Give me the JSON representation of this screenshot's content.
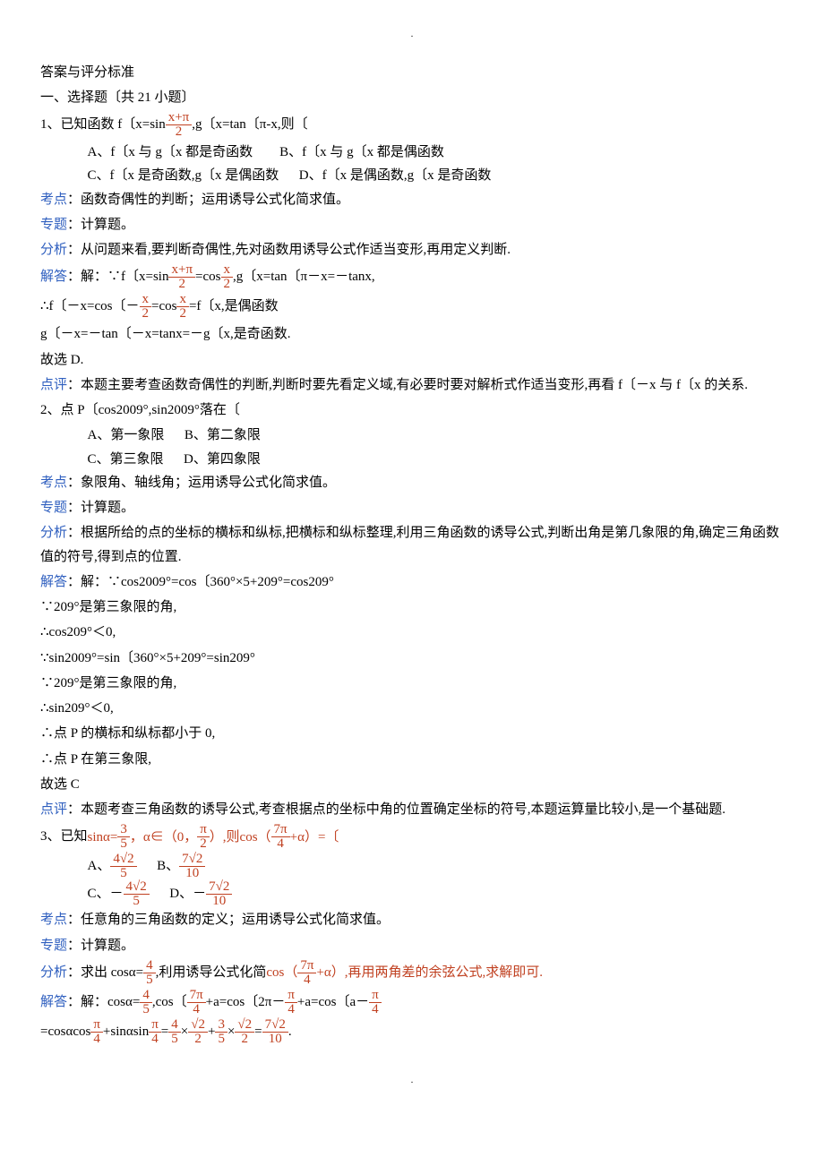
{
  "pageHeader": ".",
  "pageFooter": ".",
  "header1": "答案与评分标准",
  "header2": "一、选择题〔共 21 小题〕",
  "labels": {
    "kao": "考点",
    "zhuan": "专题",
    "fen": "分析",
    "jie": "解答",
    "ping": "点评"
  },
  "q1": {
    "stem_pre": "1、已知函数 f〔x=sin",
    "stem_post": ",g〔x=tan〔π-x,则〔",
    "frac1_num": "x+π",
    "frac1_den": "2",
    "optA": "A、f〔x 与 g〔x 都是奇函数",
    "optB": "B、f〔x 与 g〔x 都是偶函数",
    "optC": "C、f〔x 是奇函数,g〔x 是偶函数",
    "optD": "D、f〔x 是偶函数,g〔x 是奇函数",
    "kao": "：函数奇偶性的判断；运用诱导公式化简求值。",
    "zhuan": "：计算题。",
    "fen": "：从问题来看,要判断奇偶性,先对函数用诱导公式作适当变形,再用定义判断.",
    "jie_pre": "：解：∵f〔x=sin",
    "jie_mid1_num": "x+π",
    "jie_mid1_den": "2",
    "jie_mid2": "=cos",
    "jie_mid3_num": "x",
    "jie_mid3_den": "2",
    "jie_post": ",g〔x=tan〔π－x=－tanx,",
    "line2_pre": "∴f〔－x=cos〔－",
    "line2_mid_num": "x",
    "line2_mid_den": "2",
    "line2_mid2": "=cos",
    "line2_mid3_num": "x",
    "line2_mid3_den": "2",
    "line2_post": "=f〔x,是偶函数",
    "line3": "g〔－x=－tan〔－x=tanx=－g〔x,是奇函数.",
    "line4": "故选 D.",
    "ping": "：本题主要考查函数奇偶性的判断,判断时要先看定义域,有必要时要对解析式作适当变形,再看 f〔－x 与 f〔x 的关系."
  },
  "q2": {
    "stem": "2、点 P〔cos2009°,sin2009°落在〔",
    "optA": "A、第一象限",
    "optB": "B、第二象限",
    "optC": "C、第三象限",
    "optD": "D、第四象限",
    "kao": "：象限角、轴线角；运用诱导公式化简求值。",
    "zhuan": "：计算题。",
    "fen": "：根据所给的点的坐标的横标和纵标,把横标和纵标整理,利用三角函数的诱导公式,判断出角是第几象限的角,确定三角函数值的符号,得到点的位置.",
    "jie1": "：解：∵cos2009°=cos〔360°×5+209°=cos209°",
    "jie2": "∵209°是第三象限的角,",
    "jie3": "∴cos209°＜0,",
    "jie4": "∵sin2009°=sin〔360°×5+209°=sin209°",
    "jie5": "∵209°是第三象限的角,",
    "jie6": "∴sin209°＜0,",
    "jie7": "∴点 P 的横标和纵标都小于 0,",
    "jie8": "∴点 P 在第三象限,",
    "jie9": "故选 C",
    "ping": "：本题考查三角函数的诱导公式,考查根据点的坐标中角的位置确定坐标的符号,本题运算量比较小,是一个基础题."
  },
  "q3": {
    "stem_pre": "3、已知",
    "stem_sin": "sinα=",
    "stem_f1_num": "3",
    "stem_f1_den": "5",
    "stem_mid": "，α∈（0，",
    "stem_f2_num": "π",
    "stem_f2_den": "2",
    "stem_mid2": "）,则",
    "stem_cos": "cos（",
    "stem_f3_num": "7π",
    "stem_f3_den": "4",
    "stem_post": "+α）=〔",
    "optA_pre": "A、",
    "optA_num": "4√2",
    "optA_den": "5",
    "optB_pre": "B、",
    "optB_num": "7√2",
    "optB_den": "10",
    "optC_pre": "C、－",
    "optC_num": "4√2",
    "optC_den": "5",
    "optD_pre": "D、－",
    "optD_num": "7√2",
    "optD_den": "10",
    "kao": "：任意角的三角函数的定义；运用诱导公式化简求值。",
    "zhuan": "：计算题。",
    "fen_pre": "：求出 cosα=",
    "fen_f1_num": "4",
    "fen_f1_den": "5",
    "fen_mid": ",利用诱导公式化简",
    "fen_cos": "cos（",
    "fen_f2_num": "7π",
    "fen_f2_den": "4",
    "fen_post": "+α）,再用两角差的余弦公式,求解即可.",
    "jie_pre": "：解：cosα=",
    "jie_f1_num": "4",
    "jie_f1_den": "5",
    "jie_mid1": ",cos〔",
    "jie_f2_num": "7π",
    "jie_f2_den": "4",
    "jie_mid2": "+a=cos〔2π－",
    "jie_f3_num": "π",
    "jie_f3_den": "4",
    "jie_mid3": "+a=cos〔a－",
    "jie_f4_num": "π",
    "jie_f4_den": "4",
    "l2_pre": "=cosαcos",
    "l2_f1_num": "π",
    "l2_f1_den": "4",
    "l2_mid1": "+sinαsin",
    "l2_f2_num": "π",
    "l2_f2_den": "4",
    "l2_mid2": "=",
    "l2_f3_num": "4",
    "l2_f3_den": "5",
    "l2_mid3": "×",
    "l2_f4_num": "√2",
    "l2_f4_den": "2",
    "l2_mid4": "+",
    "l2_f5_num": "3",
    "l2_f5_den": "5",
    "l2_mid5": "×",
    "l2_f6_num": "√2",
    "l2_f6_den": "2",
    "l2_mid6": "=",
    "l2_f7_num": "7√2",
    "l2_f7_den": "10",
    "l2_post": "."
  }
}
